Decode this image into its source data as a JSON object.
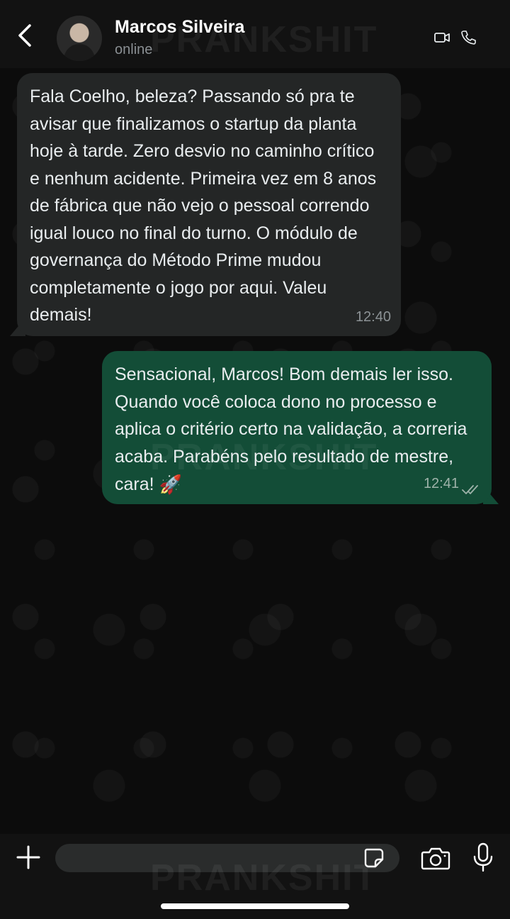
{
  "header": {
    "contact_name": "Marcos Silveira",
    "status": "online",
    "icons": [
      "back-arrow-icon",
      "video-call-icon",
      "phone-call-icon"
    ]
  },
  "watermark": "PRANKSHIT",
  "messages": [
    {
      "direction": "incoming",
      "text": "Fala Coelho, beleza? Passando só pra te avisar que finalizamos o startup da planta hoje à tarde. Zero desvio no caminho crítico e nenhum acidente. Primeira vez em 8 anos de fábrica que não vejo o pessoal correndo igual louco no final do turno. O módulo de governança do Método Prime mudou completamente o jogo por aqui. Valeu demais!",
      "time": "12:40"
    },
    {
      "direction": "outgoing",
      "text": "Sensacional, Marcos! Bom demais ler isso. Quando você coloca dono no processo e aplica o critério certo na validação, a correria acaba. Parabéns pelo resultado de mestre, cara!",
      "emoji": "🚀",
      "time": "12:41",
      "status": "read"
    }
  ],
  "composer": {
    "input_value": "",
    "icons": [
      "plus-icon",
      "sticker-icon",
      "camera-icon",
      "microphone-icon"
    ]
  },
  "colors": {
    "header_bg": "#121212",
    "incoming_bubble": "#242626",
    "outgoing_bubble": "#134d37",
    "background": "#0b0b0b"
  }
}
